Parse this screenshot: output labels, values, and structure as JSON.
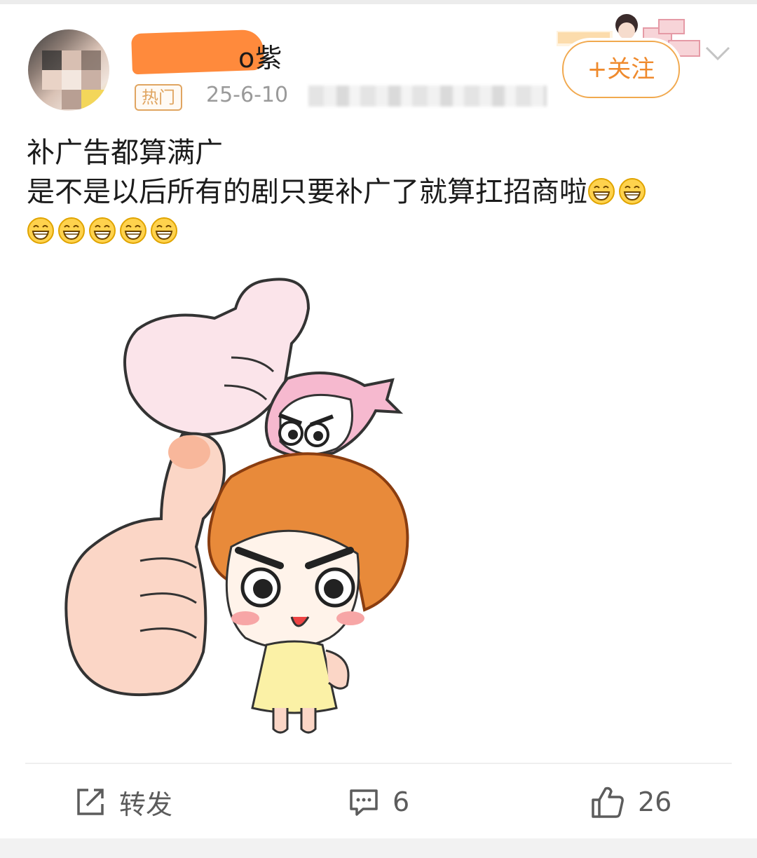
{
  "post": {
    "username_visible": "o紫",
    "hot_badge": "热门",
    "date": "25-6-10",
    "follow_label": "+关注",
    "text_line1": "补广告都算满广",
    "text_line2": "是不是以后所有的剧只要补广了就算扛招商啦",
    "emoji_icon": "grin-emoji-icon"
  },
  "actions": {
    "repost_label": "转发",
    "comment_count": "6",
    "like_count": "26"
  },
  "colors": {
    "accent_orange": "#ef8a2d",
    "follow_border": "#f1a94f",
    "hot_badge": "#e0a561",
    "username_mask": "#ff8a3c"
  }
}
